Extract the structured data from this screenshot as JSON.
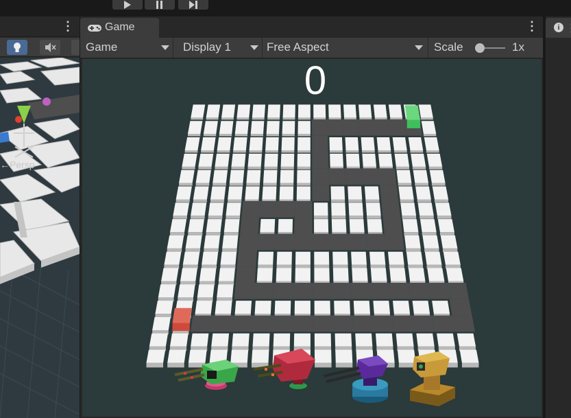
{
  "toolbar": {
    "play_icon": "play-icon",
    "pause_icon": "pause-icon",
    "step_icon": "step-icon"
  },
  "scene": {
    "lighting_icon": "lightbulb-icon",
    "audio_icon": "audio-mute-icon",
    "persp_label": "←Persp"
  },
  "game": {
    "tab_label": "Game",
    "tab_icon": "gamepad-icon",
    "menu_icon": "kebab-menu-icon",
    "dropdowns": {
      "mode": "Game",
      "display": "Display 1",
      "aspect": "Free Aspect"
    },
    "scale_label": "Scale",
    "scale_value": "1x",
    "scale_level": 0,
    "score": "0",
    "colors": {
      "path": "#4e4e4e",
      "tile": "#f2f2f2",
      "start": "#d04a3c",
      "goal": "#3fbf5c",
      "background": "#2b3a3a"
    },
    "towers": [
      {
        "name": "green-tower",
        "color": "#3aa64a"
      },
      {
        "name": "red-tower",
        "color": "#b02a3e"
      },
      {
        "name": "purple-tower",
        "color": "#5a2a9a"
      },
      {
        "name": "brown-tower",
        "color": "#a8782a"
      }
    ]
  },
  "inspector": {
    "icon": "info-icon",
    "icon_glyph": "i"
  }
}
